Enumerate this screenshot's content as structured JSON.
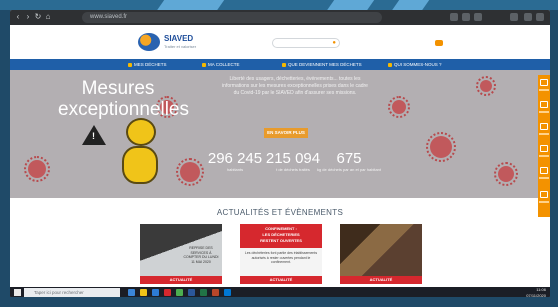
{
  "browser": {
    "url": "www.siaved.fr"
  },
  "site": {
    "logo_name": "SIAVED",
    "logo_subtitle": "Traiter et valoriser"
  },
  "nav": {
    "items": [
      {
        "label": "MES DÉCHETS"
      },
      {
        "label": "MA COLLECTE"
      },
      {
        "label": "QUE DEVIENNENT MES DÉCHETS"
      },
      {
        "label": "QUI SOMMES-NOUS ?"
      }
    ]
  },
  "hero": {
    "title_line1": "Mesures",
    "title_line2": "exceptionnelles",
    "text": "Liberté des usagers, déchetteries, événements... toutes les informations sur les mesures exceptionnelles prises dans le cadre du Covid-19 par le SIAVED afin d'assurer ses missions.",
    "button_label": "EN SAVOIR PLUS",
    "stats": [
      {
        "value": "296 245",
        "label": "habitants"
      },
      {
        "value": "215 094",
        "label": "t de déchets traités"
      },
      {
        "value": "675",
        "label": "kg de déchets par an et par habitant"
      }
    ]
  },
  "news": {
    "title": "ACTUALITÉS ET ÉVÈNEMENTS",
    "cards": [
      {
        "caption": "REPRISE DES SERVICES À COMPTER DU LUNDI 11 MAI 2020",
        "cta": "ACTUALITÉ"
      },
      {
        "banner_line1": "CONFINEMENT :",
        "banner_line2": "LES DÉCHETERIES",
        "banner_line3": "RESTENT OUVERTES",
        "text": "Les déchèteries font partie des établissements autorisés à rester ouvertes pendant le confinement.",
        "cta": "ACTUALITÉ"
      },
      {
        "cta": "ACTUALITÉ"
      }
    ]
  },
  "taskbar": {
    "search_placeholder": "Taper ici pour rechercher",
    "time": "11:06",
    "date": "07/11/2020"
  },
  "colors": {
    "nav_blue": "#1f5fa8",
    "accent_orange": "#f39200",
    "cta_red": "#d6282e",
    "hero_gray": "#b3afb2"
  }
}
